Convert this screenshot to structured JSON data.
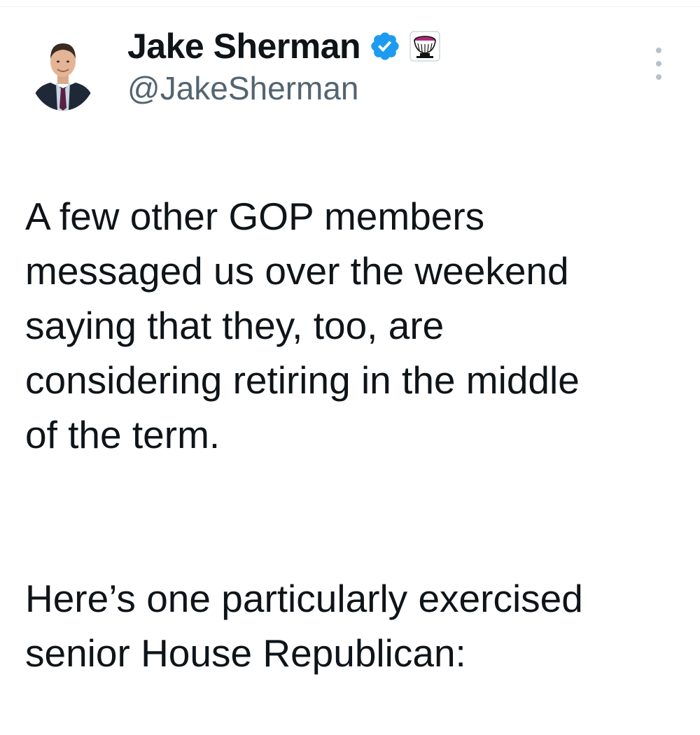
{
  "tweet": {
    "author": {
      "display_name": "Jake Sherman",
      "handle": "@JakeSherman",
      "verified_icon": "verified-badge-icon",
      "affiliation_icon": "affiliate-badge-icon",
      "avatar_icon": "avatar"
    },
    "more_icon": "more-options-icon",
    "paragraphs": [
      "A few other GOP members\nmessaged us over the weekend\nsaying that they, too, are\nconsidering retiring in the middle\nof the term.",
      "Here’s one particularly exercised\nsenior House Republican:"
    ]
  },
  "colors": {
    "text": "#0f1419",
    "secondary": "#536471",
    "verified_blue": "#1d9bf0",
    "divider": "#eff3f4"
  }
}
